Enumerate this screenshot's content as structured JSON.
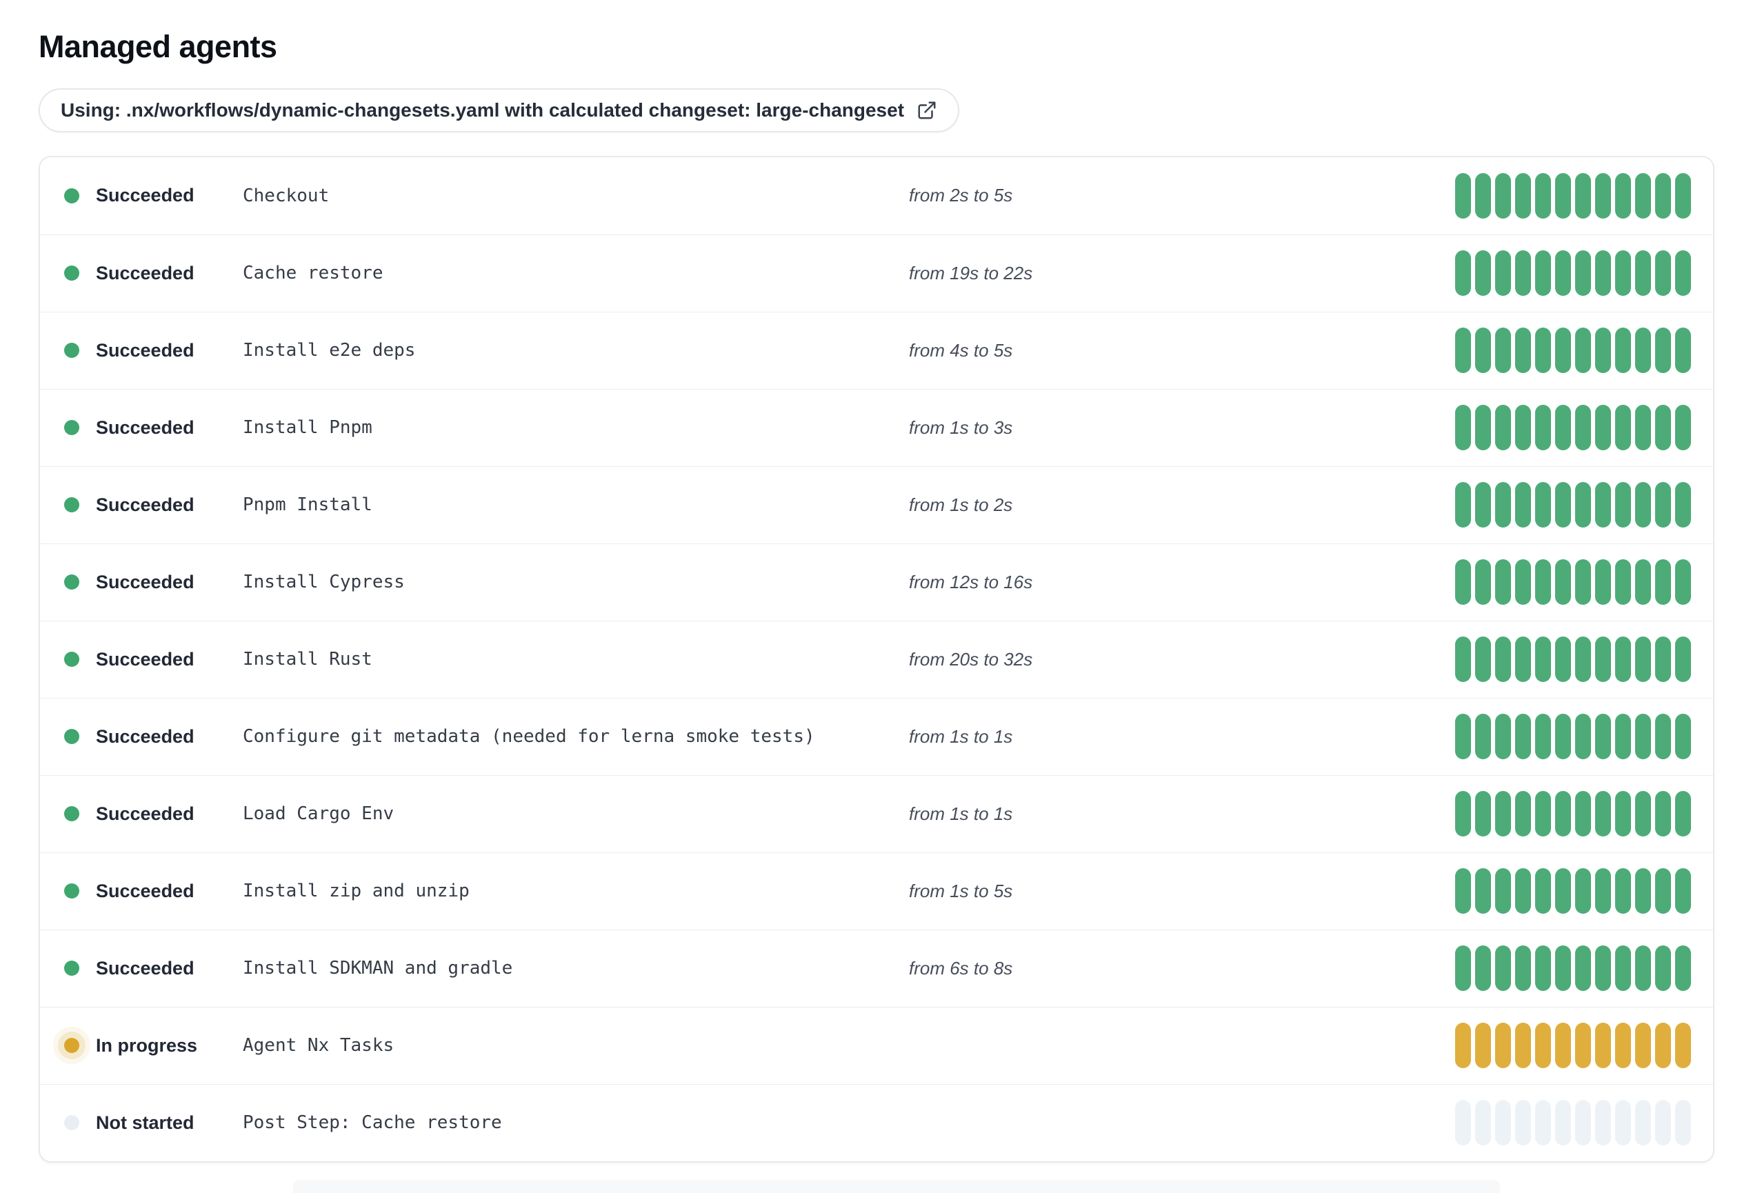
{
  "page": {
    "title": "Managed agents"
  },
  "workflow_chip": {
    "text": "Using: .nx/workflows/dynamic-changesets.yaml with calculated changeset: large-changeset",
    "icon": "external-link-icon"
  },
  "agents": {
    "segments_per_row": 12,
    "rows": [
      {
        "status": "Succeeded",
        "state": "succeeded",
        "name": "Checkout",
        "duration": "from 2s to 5s"
      },
      {
        "status": "Succeeded",
        "state": "succeeded",
        "name": "Cache restore",
        "duration": "from 19s to 22s"
      },
      {
        "status": "Succeeded",
        "state": "succeeded",
        "name": "Install e2e deps",
        "duration": "from 4s to 5s"
      },
      {
        "status": "Succeeded",
        "state": "succeeded",
        "name": "Install Pnpm",
        "duration": "from 1s to 3s"
      },
      {
        "status": "Succeeded",
        "state": "succeeded",
        "name": "Pnpm Install",
        "duration": "from 1s to 2s"
      },
      {
        "status": "Succeeded",
        "state": "succeeded",
        "name": "Install Cypress",
        "duration": "from 12s to 16s"
      },
      {
        "status": "Succeeded",
        "state": "succeeded",
        "name": "Install Rust",
        "duration": "from 20s to 32s"
      },
      {
        "status": "Succeeded",
        "state": "succeeded",
        "name": "Configure git metadata (needed for lerna smoke tests)",
        "duration": "from 1s to 1s"
      },
      {
        "status": "Succeeded",
        "state": "succeeded",
        "name": "Load Cargo Env",
        "duration": "from 1s to 1s"
      },
      {
        "status": "Succeeded",
        "state": "succeeded",
        "name": "Install zip and unzip",
        "duration": "from 1s to 5s"
      },
      {
        "status": "Succeeded",
        "state": "succeeded",
        "name": "Install SDKMAN and gradle",
        "duration": "from 6s to 8s"
      },
      {
        "status": "In progress",
        "state": "in-progress",
        "name": "Agent Nx Tasks",
        "duration": ""
      },
      {
        "status": "Not started",
        "state": "not-started",
        "name": "Post Step: Cache restore",
        "duration": ""
      }
    ]
  },
  "colors": {
    "succeeded_pill": "#4dab77",
    "succeeded_dot": "#3fa66e",
    "in_progress_pill": "#dfae3d",
    "in_progress_dot": "#d9a62b",
    "in_progress_halo": "#f5e9cc",
    "not_started_pill": "#edf2f7",
    "not_started_dot": "#e9eef4"
  }
}
